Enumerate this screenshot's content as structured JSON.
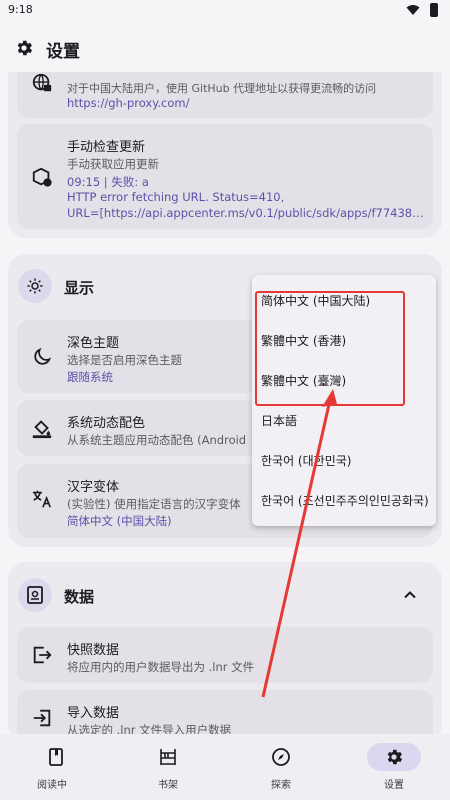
{
  "status_bar": {
    "time": "9:18"
  },
  "app_bar": {
    "title": "设置",
    "icon": "gear-icon"
  },
  "network": {
    "proxy_desc": "对于中国大陆用户，使用 GitHub 代理地址以获得更流畅的访问",
    "proxy_url": "https://gh-proxy.com/",
    "icon": "globe-lock-icon"
  },
  "update": {
    "title": "手动检查更新",
    "subtitle": "手动获取应用更新",
    "status": "09:15 | 失败: a",
    "error1": "HTTP error fetching URL. Status=410,",
    "error2": "URL=[https://api.appcenter.ms/v0.1/public/sdk/apps/f77438…",
    "icon": "update-box-icon"
  },
  "display": {
    "title": "显示",
    "icon": "brightness-icon",
    "dark_theme": {
      "title": "深色主题",
      "subtitle": "选择是否启用深色主题",
      "value": "跟随系统",
      "icon": "moon-icon"
    },
    "dynamic_color": {
      "title": "系统动态配色",
      "subtitle": "从系统主题应用动态配色 (Android",
      "icon": "paint-bucket-icon"
    },
    "han_variant": {
      "title": "汉字变体",
      "subtitle": "(实验性) 使用指定语言的汉字变体",
      "value": "简体中文 (中国大陆)",
      "icon": "translate-icon"
    }
  },
  "language_menu": {
    "options": [
      "简体中文 (中国大陆)",
      "繁體中文 (香港)",
      "繁體中文 (臺灣)",
      "日本語",
      "한국어 (대한민국)",
      "한국어 (조선민주주의인민공화국)"
    ],
    "highlight_color": "#e53935"
  },
  "data_section": {
    "title": "数据",
    "icon": "data-box-icon",
    "collapse_icon": "chevron-up-icon",
    "snapshot": {
      "title": "快照数据",
      "subtitle": "将应用内的用户数据导出为 .lnr 文件",
      "icon": "export-icon"
    },
    "import": {
      "title": "导入数据",
      "subtitle": "从选定的 .lnr 文件导入用户数据",
      "icon": "import-icon"
    }
  },
  "bottom_nav": [
    {
      "label": "阅读中",
      "icon": "book-icon"
    },
    {
      "label": "书架",
      "icon": "bookshelf-icon"
    },
    {
      "label": "探索",
      "icon": "compass-icon"
    },
    {
      "label": "设置",
      "icon": "gear-icon"
    }
  ],
  "accent": "#5a52a8"
}
